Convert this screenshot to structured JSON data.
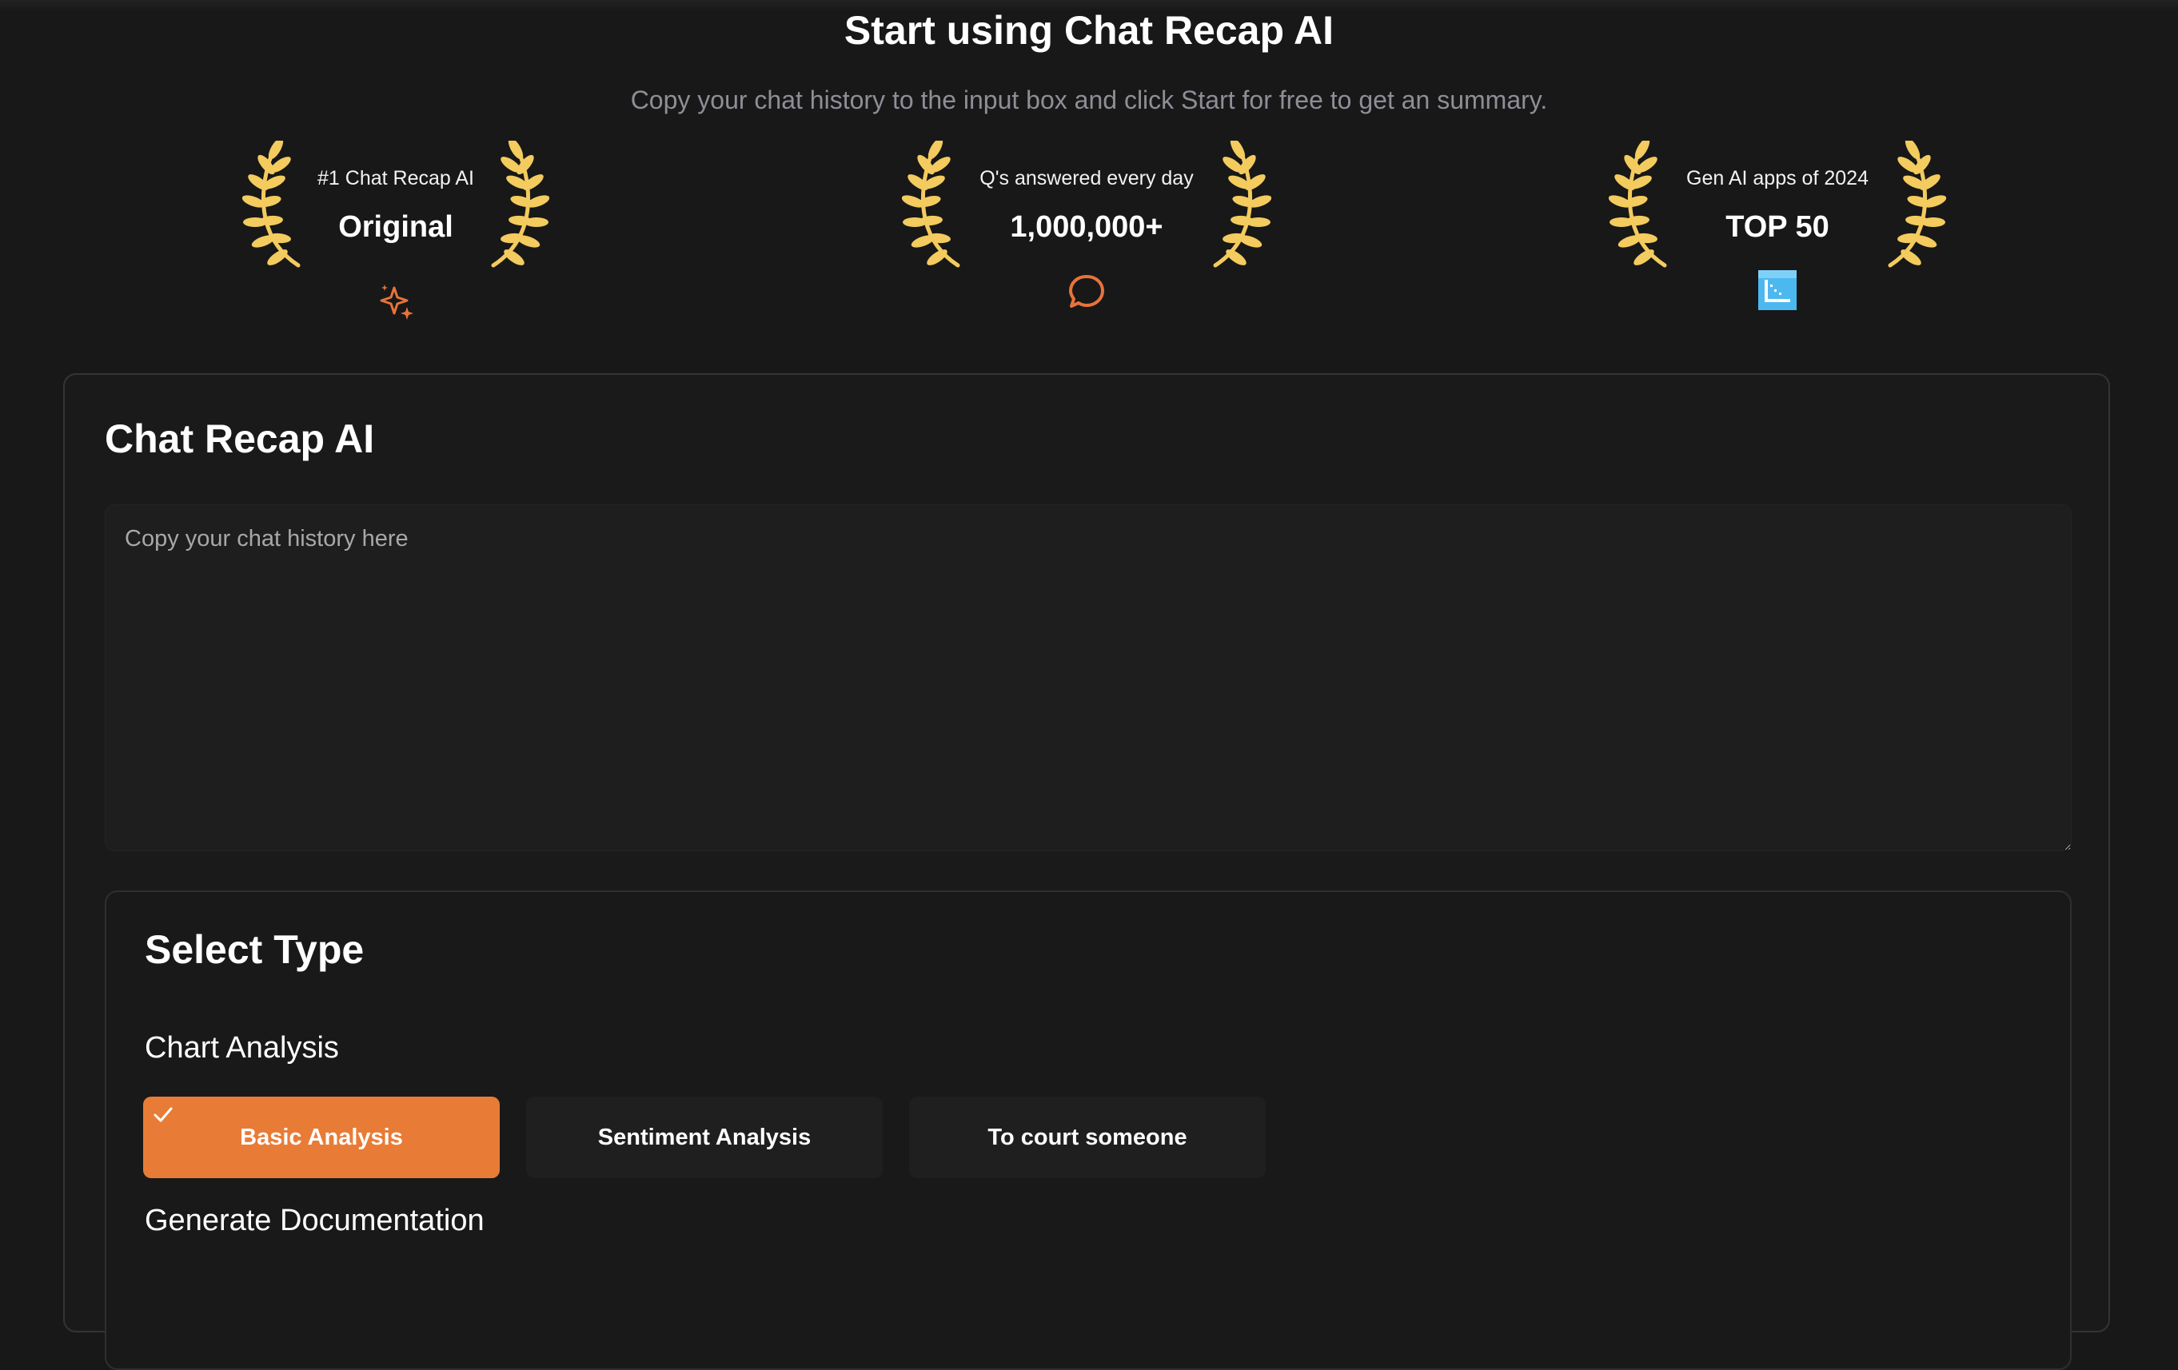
{
  "hero": {
    "title": "Start using Chat Recap AI",
    "subtitle": "Copy your chat history to the input box and click Start for free to get an summary."
  },
  "badges": [
    {
      "top": "#1 Chat Recap AI",
      "main": "Original",
      "icon": "sparkle-icon",
      "icon_color": "#e8733a"
    },
    {
      "top": "Q's answered every day",
      "main": "1,000,000+",
      "icon": "chat-bubble-icon",
      "icon_color": "#e8733a"
    },
    {
      "top": "Gen AI apps of 2024",
      "main": "TOP 50",
      "icon": "chart-logo-icon",
      "icon_color": "#4cb8f0"
    }
  ],
  "tool": {
    "title": "Chat Recap AI",
    "input_placeholder": "Copy your chat history here",
    "input_value": ""
  },
  "select_type": {
    "title": "Select Type",
    "groups": [
      {
        "label": "Chart Analysis",
        "options": [
          {
            "label": "Basic Analysis",
            "selected": true
          },
          {
            "label": "Sentiment Analysis",
            "selected": false
          },
          {
            "label": "To court someone",
            "selected": false
          }
        ]
      },
      {
        "label": "Generate Documentation",
        "options": []
      }
    ]
  },
  "colors": {
    "background": "#181818",
    "accent": "#e87c37",
    "laurel_gold": "#f3cb5e",
    "muted_text": "#8e8e96"
  }
}
